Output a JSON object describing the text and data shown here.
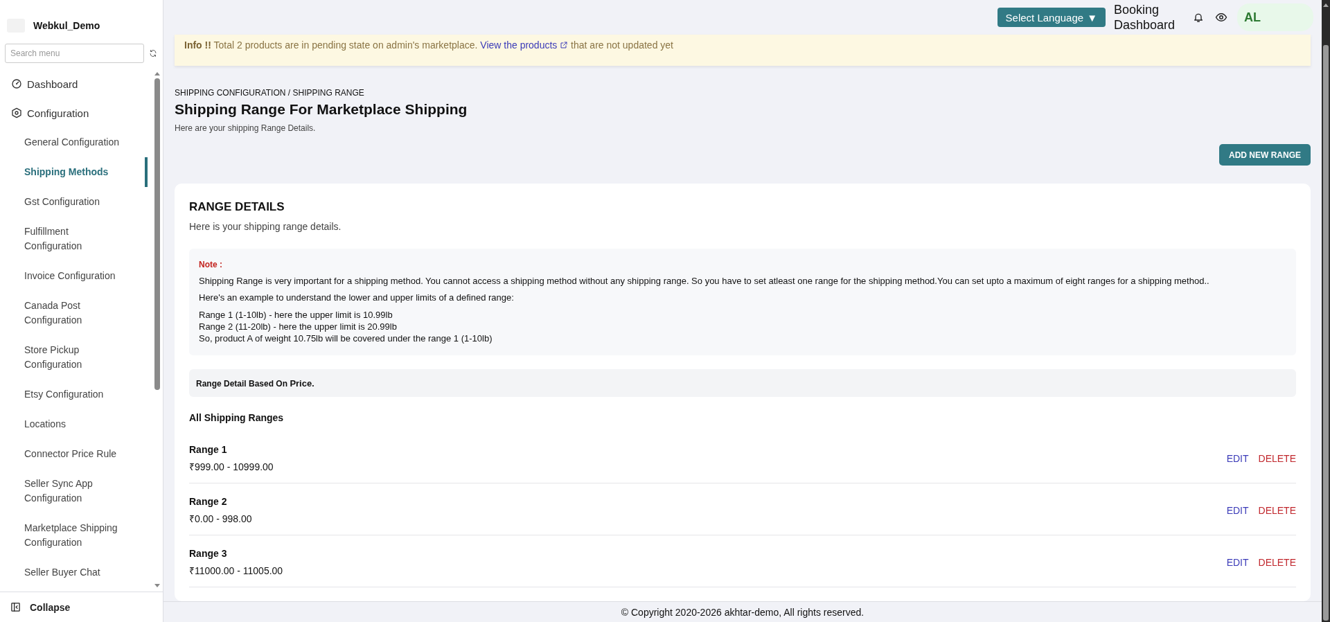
{
  "sidebar": {
    "brand": "Webkul_Demo",
    "search": {
      "placeholder": "Search menu"
    },
    "items": [
      {
        "label": "Dashboard",
        "selected": false
      },
      {
        "label": "Configuration",
        "selected": false,
        "children": [
          {
            "label": "General Configuration",
            "selected": false
          },
          {
            "label": "Shipping Methods",
            "selected": true
          },
          {
            "label": "Gst Configuration",
            "selected": false
          },
          {
            "label": "Fulfillment Configuration",
            "selected": false
          },
          {
            "label": "Invoice Configuration",
            "selected": false
          },
          {
            "label": "Canada Post Configuration",
            "selected": false
          },
          {
            "label": "Store Pickup Configuration",
            "selected": false
          },
          {
            "label": "Etsy Configuration",
            "selected": false
          },
          {
            "label": "Locations",
            "selected": false
          },
          {
            "label": "Connector Price Rule",
            "selected": false
          },
          {
            "label": "Seller Sync App Configuration",
            "selected": false
          },
          {
            "label": "Marketplace Shipping Configuration",
            "selected": false
          },
          {
            "label": "Seller Buyer Chat",
            "selected": false
          }
        ]
      }
    ],
    "collapse": "Collapse"
  },
  "topbar": {
    "language_button": "Select Language",
    "language_caret": "▼",
    "booking_link": "Booking Dashboard",
    "avatar": "AL"
  },
  "banner": {
    "lead": "Info !!",
    "text": "Total 2 products are in pending state on admin's marketplace.",
    "link": "View the products",
    "tail": "that are not updated yet"
  },
  "page": {
    "breadcrumb": "SHIPPING CONFIGURATION / SHIPPING RANGE",
    "title": "Shipping Range For Marketplace Shipping",
    "subtitle": "Here are your shipping Range Details.",
    "add_button": "ADD NEW RANGE"
  },
  "card": {
    "title": "RANGE DETAILS",
    "subtitle": "Here is your shipping range details.",
    "note": {
      "label": "Note :",
      "lines": [
        "Shipping Range is very important for a shipping method. You cannot access a shipping method without any shipping range. So you have to set atleast one range for the shipping method.You can set upto a maximum of eight ranges for a shipping method..",
        "Here's an example to understand the lower and upper limits of a defined range:"
      ],
      "examples": [
        "Range 1 (1-10lb) - here the upper limit is 10.99lb",
        "Range 2 (11-20lb) - here the upper limit is 20.99lb",
        "So, product A of weight 10.75lb will be covered under the range 1 (1-10lb)"
      ]
    },
    "basis": "Range Detail Based On  **Price**.",
    "list_title": "All Shipping Ranges",
    "ranges": [
      {
        "name": "Range 1",
        "range": "₹999.00 - 10999.00",
        "edit": "EDIT",
        "delete": "DELETE"
      },
      {
        "name": "Range 2",
        "range": "₹0.00 - 998.00",
        "edit": "EDIT",
        "delete": "DELETE"
      },
      {
        "name": "Range 3",
        "range": "₹11000.00 - 11005.00",
        "edit": "EDIT",
        "delete": "DELETE"
      }
    ]
  },
  "footer": "© Copyright 2020-2026 akhtar-demo, All rights reserved."
}
